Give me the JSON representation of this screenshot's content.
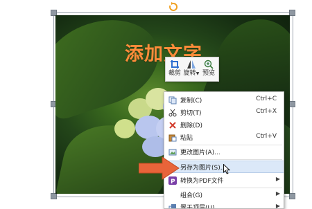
{
  "image_caption": "添加文字",
  "mini_toolbar": {
    "items": [
      {
        "label": "裁剪",
        "dropdown": false,
        "icon": "crop-icon"
      },
      {
        "label": "旋转",
        "dropdown": true,
        "icon": "rotate-icon"
      },
      {
        "label": "预览",
        "dropdown": false,
        "icon": "zoom-icon"
      }
    ]
  },
  "context_menu": {
    "items": [
      {
        "label": "复制(C)",
        "shortcut": "Ctrl+C",
        "icon": "copy-icon"
      },
      {
        "label": "剪切(T)",
        "shortcut": "Ctrl+X",
        "icon": "scissors-icon"
      },
      {
        "label": "删除(D)",
        "shortcut": "",
        "icon": "delete-x-icon"
      },
      {
        "label": "粘贴",
        "shortcut": "Ctrl+V",
        "icon": "paste-icon"
      },
      {
        "label": "更改图片(A)...",
        "shortcut": "",
        "icon": "change-picture-icon"
      },
      {
        "label": "另存为图片(S)...",
        "shortcut": "",
        "icon": "save-as-picture-icon",
        "highlighted": true
      },
      {
        "label": "转换为PDF文件",
        "shortcut": "",
        "icon": "pdf-icon",
        "submenu": true
      },
      {
        "label": "组合(G)",
        "shortcut": "",
        "icon": "",
        "submenu": true
      },
      {
        "label": "置于顶层(U)",
        "shortcut": "",
        "icon": "bring-to-front-icon",
        "submenu": true
      }
    ]
  },
  "colors": {
    "caption": "#ff8c3a",
    "arrow": "#e8643a",
    "highlight": "#dbe8f8"
  }
}
